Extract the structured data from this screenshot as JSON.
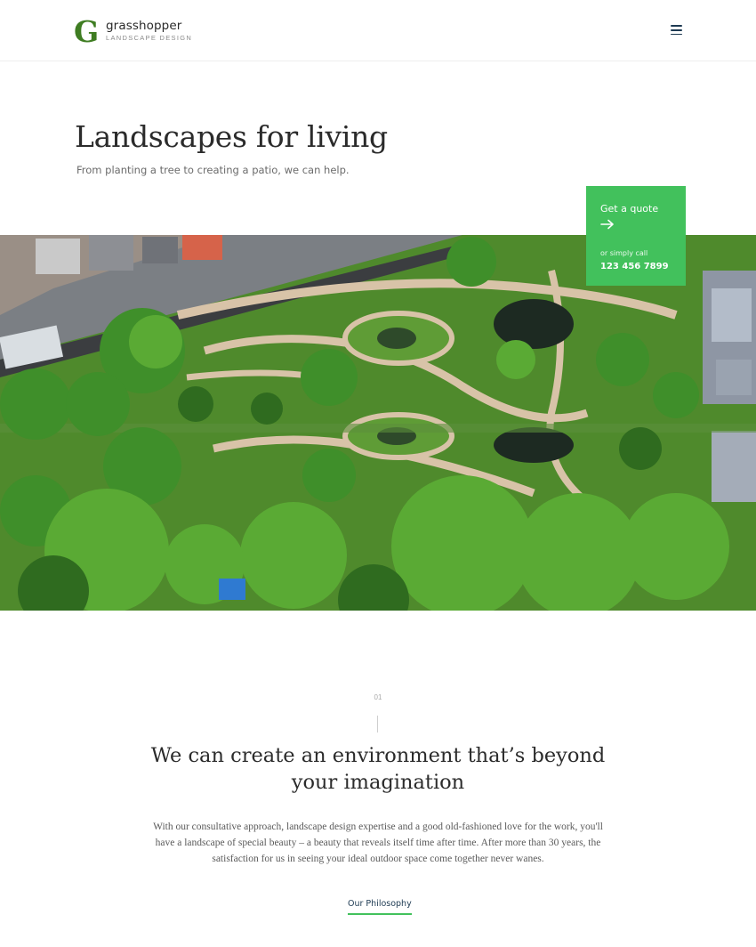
{
  "header": {
    "brand_name": "grasshopper",
    "brand_tagline": "LANDSCAPE DESIGN",
    "logo_letter": "G",
    "menu_icon": "hamburger-menu-icon"
  },
  "hero": {
    "title": "Landscapes for living",
    "subtitle": "From planting a tree to creating a patio, we can help.",
    "image_alt": "aerial view of landscaped garden"
  },
  "quote_card": {
    "title": "Get a quote",
    "arrow_icon": "arrow-right-icon",
    "call_label": "or simply call",
    "phone": "123 456 7899"
  },
  "intro": {
    "number": "01",
    "title": "We can create an environment that’s beyond your imagination",
    "body": "With our consultative approach, landscape design expertise and a good old-fashioned love for the work, you'll have a landscape of special beauty – a beauty that reveals itself time after time. After more than 30 years, the satisfaction for us in seeing your ideal outdoor space come together never wanes.",
    "link_label": "Our Philosophy"
  },
  "colors": {
    "accent_green": "#42c15c",
    "navy": "#1d3a52"
  }
}
